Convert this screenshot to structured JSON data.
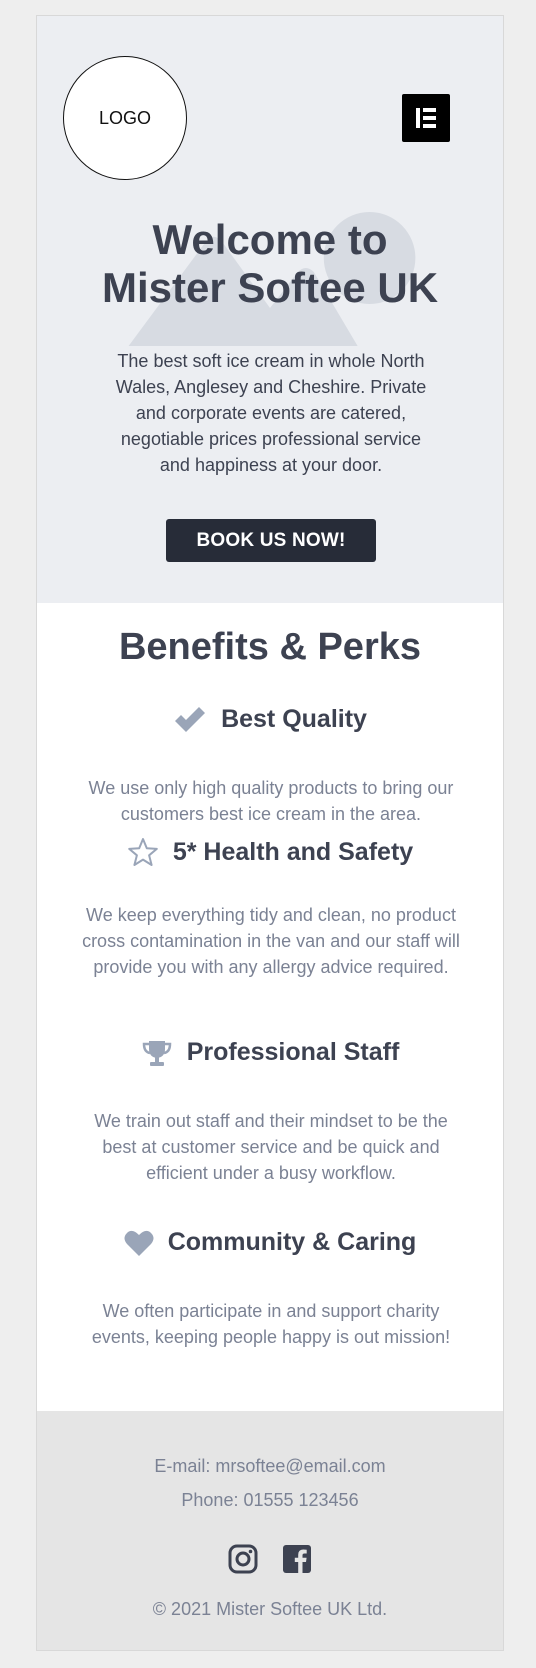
{
  "hero": {
    "logo_text": "LOGO",
    "title_line1": "Welcome to",
    "title_line2": "Mister Softee UK",
    "description": "The best soft ice cream in whole North Wales, Anglesey and Cheshire. Private and corporate events are catered, negotiable prices professional service and happiness at your door.",
    "cta_label": "BOOK US NOW!"
  },
  "benefits": {
    "title": "Benefits & Perks",
    "items": [
      {
        "icon": "check-icon",
        "title": "Best Quality",
        "text": "We use only high quality products to bring our customers best ice cream in the area."
      },
      {
        "icon": "star-icon",
        "title": "5* Health and Safety",
        "text": "We keep everything tidy and clean, no product cross contamination in the van and our staff will provide you with any allergy advice required."
      },
      {
        "icon": "trophy-icon",
        "title": "Professional Staff",
        "text": "We train out staff and their mindset to be the best at customer service and be quick and efficient under a busy workflow."
      },
      {
        "icon": "heart-icon",
        "title": "Community & Caring",
        "text": "We often participate in and support charity events, keeping people happy is out mission!"
      }
    ]
  },
  "footer": {
    "email": "E-mail: mrsoftee@email.com",
    "phone": "Phone: 01555 123456",
    "social": [
      "instagram-icon",
      "facebook-icon"
    ],
    "copyright": "© 2021  Mister Softee UK Ltd."
  },
  "colors": {
    "page_bg": "#eeeeee",
    "hero_bg": "#eceef2",
    "heading": "#3d4251",
    "body_text": "#7b8294",
    "icon": "#9aa5b8",
    "button_bg": "#272c38",
    "footer_bg": "#e5e5e5"
  }
}
